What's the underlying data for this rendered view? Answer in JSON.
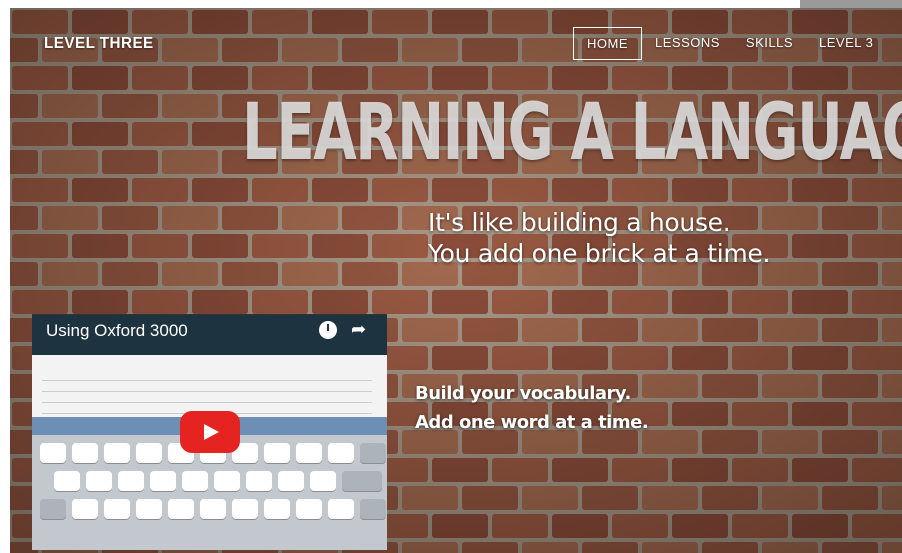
{
  "site": {
    "brand": "LEVEL THREE"
  },
  "nav": {
    "items": [
      {
        "label": "HOME",
        "active": true
      },
      {
        "label": "LESSONS",
        "active": false
      },
      {
        "label": "SKILLS",
        "active": false
      },
      {
        "label": "LEVEL 3",
        "active": false
      }
    ]
  },
  "hero": {
    "title": "LEARNING A LANGUAGE",
    "tagline_line1": "It's like building a house.",
    "tagline_line2": "You add one brick at a time.",
    "vocab_line1": "Build your vocabulary.",
    "vocab_line2": "Add one word at a time."
  },
  "video": {
    "title": "Using Oxford 3000",
    "icons": [
      "clock-icon",
      "share-icon",
      "youtube-play-icon"
    ]
  },
  "colors": {
    "brick": "#8a5a45",
    "mortar": "#a89888",
    "video_header": "#1d3340",
    "play": "#e52421"
  }
}
